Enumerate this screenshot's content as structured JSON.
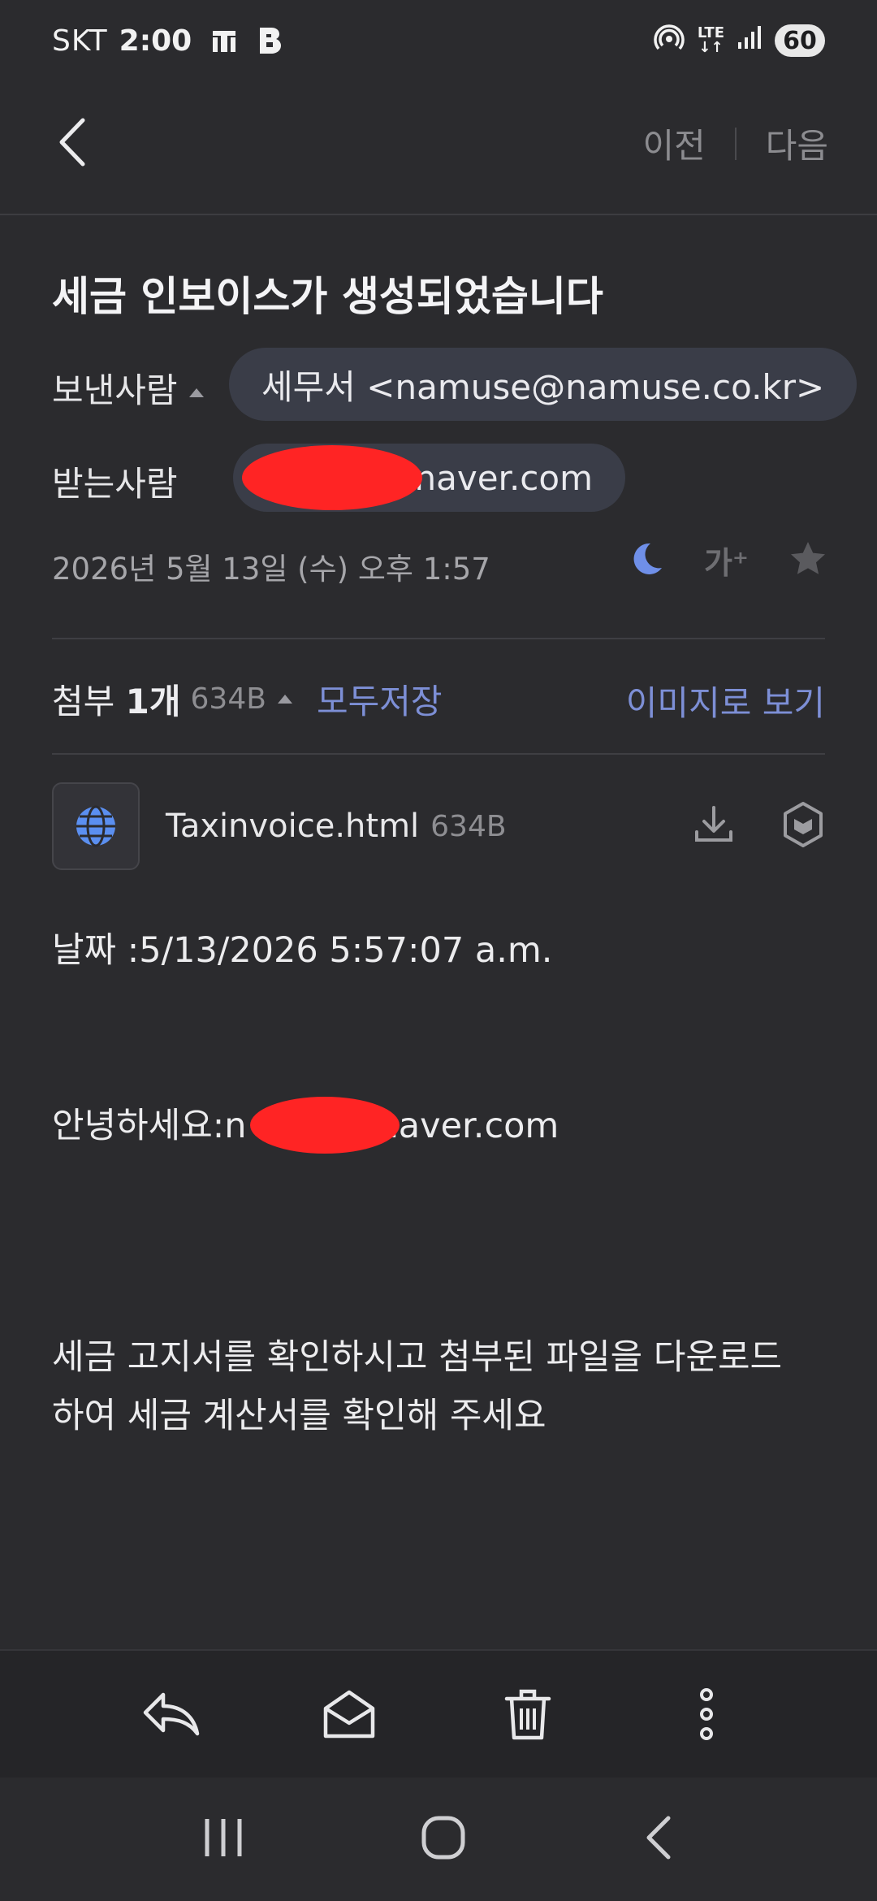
{
  "status_bar": {
    "carrier": "SKT",
    "time": "2:00",
    "lte_top": "LTE",
    "battery": "60"
  },
  "nav": {
    "prev": "이전",
    "next": "다음"
  },
  "email": {
    "subject": "세금 인보이스가 생성되었습니다",
    "sender_label": "보낸사람",
    "sender": "세무서 <namuse@namuse.co.kr>",
    "recipient_label": "받는사람",
    "recipient_visible": "@naver.com",
    "date": "2026년 5월 13일 (수) 오후 1:57",
    "font_size_icon_text": "가⁺"
  },
  "attachments": {
    "count_prefix": "첨부 ",
    "count": "1개",
    "total_size": "634B",
    "save_all": "모두저장",
    "view_as_image": "이미지로 보기",
    "files": [
      {
        "name": "Taxinvoice.html",
        "size": "634B"
      }
    ]
  },
  "body": {
    "date_line": "날짜 :5/13/2026 5:57:07 a.m.",
    "greeting_prefix": "안녕하세요:n",
    "greeting_suffix": "naver.com",
    "message_line1": "세금 고지서를 확인하시고 첨부된 파일을 다운로드",
    "message_line2": "하여 세금 계산서를 확인해 주세요"
  },
  "colors": {
    "background": "#2b2b2e",
    "accent": "#7d8fd6",
    "pill": "#3a3d48",
    "redaction": "#ff2424"
  }
}
